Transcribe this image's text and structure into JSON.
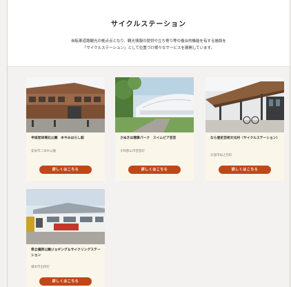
{
  "header": {
    "title": "サイクルステーション",
    "description": "自転車道路観光の拠点点となり、観光情報の提供や立ち寄り等の複合的機能を有する施設を\n「サイクルステーション」として位置づけ様々なサービスを展開しています。"
  },
  "cards": [
    {
      "name": "半城里球場北公園　木やみはらし館",
      "location": "安食市二本木公園",
      "button_label": "詳しくはこちら",
      "photo_icon": "building-photo"
    },
    {
      "name": "さぬきは健康パーク　スイムピア芸芸",
      "location": "大和郡山市芸芸町",
      "button_label": "詳しくはこちら",
      "photo_icon": "arena-photo"
    },
    {
      "name": "なら歴史芸術文化村（サイクルステーション）",
      "location": "天理市杣之内町",
      "button_label": "詳しくはこちら",
      "photo_icon": "canopy-photo"
    },
    {
      "name": "県立橿原公園ジョギング＆サイクリングステーション",
      "location": "橿本市出所町",
      "button_label": "詳しくはこちら",
      "photo_icon": "station-photo"
    }
  ],
  "colors": {
    "button": "#c0471a",
    "card_bg": "#fbf6ea",
    "page_bg": "#f3f2f0"
  }
}
